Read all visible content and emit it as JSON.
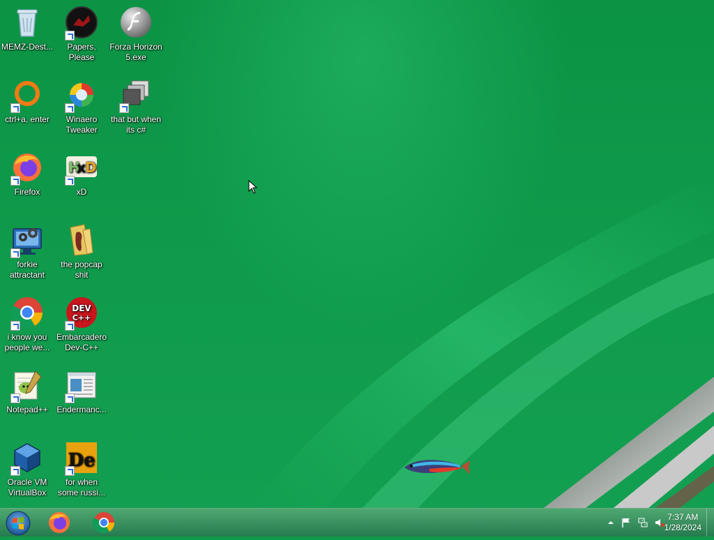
{
  "desktop": {
    "icons": [
      {
        "id": "memz",
        "label": "MEMZ-Dest...",
        "icon": "recycle-bin-icon"
      },
      {
        "id": "papers",
        "label": "Papers, Please",
        "icon": "papers-please-icon"
      },
      {
        "id": "forza",
        "label": "Forza Horizon 5.exe",
        "icon": "flash-icon"
      },
      {
        "id": "ctrla",
        "label": "ctrl+a, enter",
        "icon": "orange-ring-icon"
      },
      {
        "id": "winaero",
        "label": "Winaero Tweaker",
        "icon": "winaero-icon"
      },
      {
        "id": "csharp",
        "label": "that but when its c#",
        "icon": "stacked-windows-icon"
      },
      {
        "id": "firefox",
        "label": "Firefox",
        "icon": "firefox-icon"
      },
      {
        "id": "xd",
        "label": "xD",
        "icon": "hxd-icon"
      },
      {
        "id": "forkie",
        "label": "forkie attractant",
        "icon": "monitor-gear-icon"
      },
      {
        "id": "popcap",
        "label": "the popcap shit",
        "icon": "folder-icon"
      },
      {
        "id": "iknow",
        "label": "i know you people we...",
        "icon": "chrome-icon"
      },
      {
        "id": "devcpp",
        "label": "Embarcadero Dev-C++",
        "icon": "devcpp-icon"
      },
      {
        "id": "notepadpp",
        "label": "Notepad++",
        "icon": "notepadpp-icon"
      },
      {
        "id": "enderman",
        "label": "Endermanc...",
        "icon": "document-window-icon"
      },
      {
        "id": "vbox",
        "label": "Oracle VM VirtualBox",
        "icon": "virtualbox-icon"
      },
      {
        "id": "russian",
        "label": "for when some russi...",
        "icon": "de-icon"
      }
    ]
  },
  "taskbar": {
    "start_icon": "windows-orb-icon",
    "pinned": [
      {
        "id": "firefox",
        "icon": "firefox-icon"
      },
      {
        "id": "chrome",
        "icon": "chrome-icon"
      }
    ],
    "tray": {
      "icons": [
        "show-hidden-icons-icon",
        "action-center-flag-icon",
        "network-icon",
        "volume-muted-icon"
      ],
      "time": "7:37 AM",
      "date": "1/28/2024"
    }
  },
  "colors": {
    "wallpaper": "#0e9a4a",
    "taskbar": "#3f8f62"
  }
}
